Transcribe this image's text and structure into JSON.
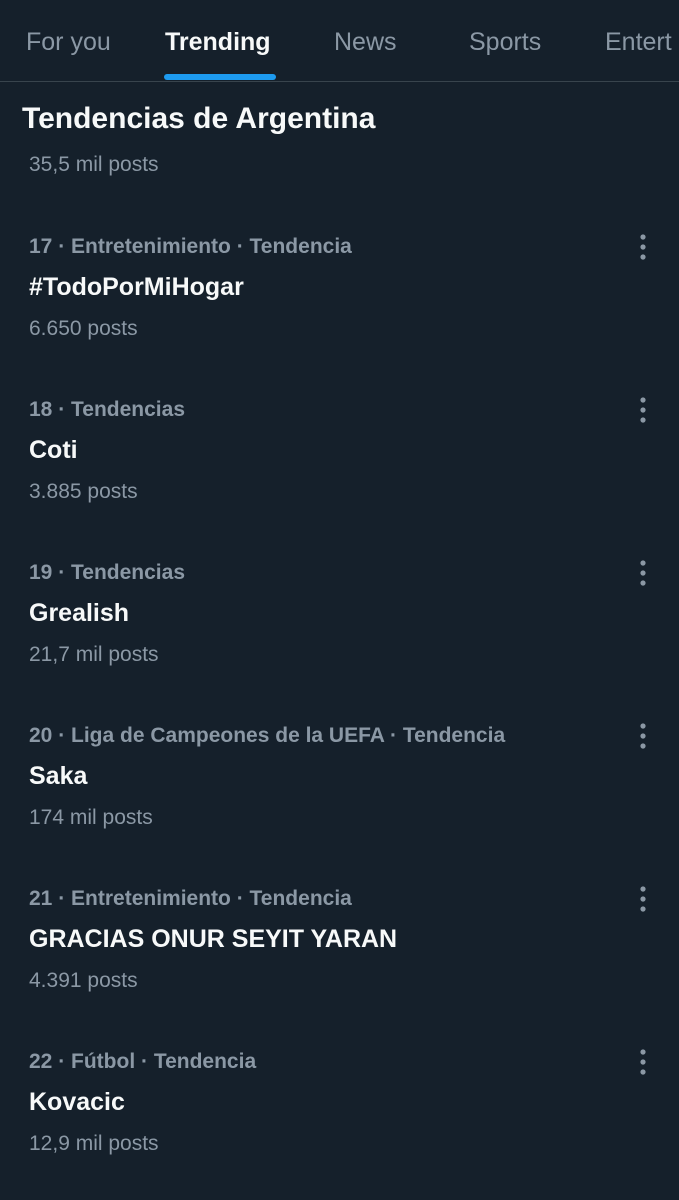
{
  "tabs": [
    {
      "label": "For you"
    },
    {
      "label": "Trending"
    },
    {
      "label": "News"
    },
    {
      "label": "Sports"
    },
    {
      "label": "Entert"
    }
  ],
  "active_tab": "Trending",
  "section_title": "Tendencias de Argentina",
  "partial_previous_count": "35,5 mil posts",
  "trends": [
    {
      "meta": "17 · Entretenimiento · Tendencia",
      "name": "#TodoPorMiHogar",
      "count": "6.650 posts"
    },
    {
      "meta": "18 · Tendencias",
      "name": "Coti",
      "count": "3.885 posts"
    },
    {
      "meta": "19 · Tendencias",
      "name": "Grealish",
      "count": "21,7 mil posts"
    },
    {
      "meta": "20 · Liga de Campeones de la UEFA · Tendencia",
      "name": "Saka",
      "count": "174 mil posts"
    },
    {
      "meta": "21 · Entretenimiento · Tendencia",
      "name": "GRACIAS ONUR SEYIT YARAN",
      "count": "4.391 posts"
    },
    {
      "meta": "22 · Fútbol · Tendencia",
      "name": "Kovacic",
      "count": "12,9 mil posts"
    }
  ],
  "icons": {
    "more": "more-vertical-icon"
  },
  "colors": {
    "background": "#15202b",
    "accent": "#1d9bf0",
    "primary_text": "#f7f9f9",
    "secondary_text": "#8b98a5",
    "divider": "#38444d"
  }
}
